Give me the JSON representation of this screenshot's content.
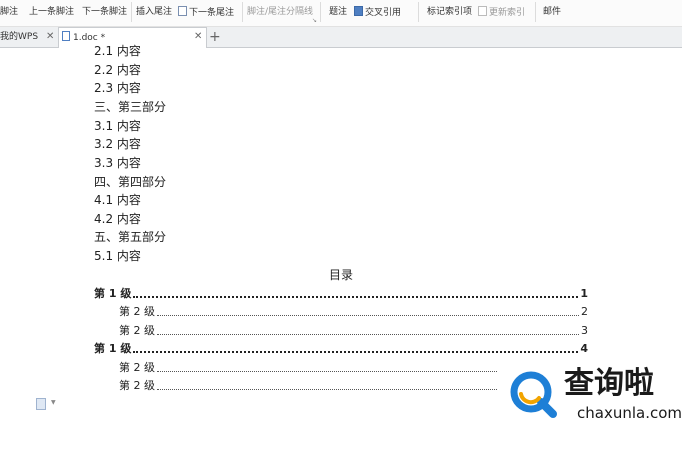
{
  "ribbon": {
    "items": [
      {
        "label": "脚注",
        "icon": "footnote-icon",
        "disabled": false
      },
      {
        "label": "上一条脚注",
        "disabled": false
      },
      {
        "label": "下一条脚注",
        "disabled": false
      },
      {
        "label": "插入尾注",
        "disabled": false
      },
      {
        "label": "下一条尾注",
        "icon": "next-endnote-icon",
        "disabled": false
      },
      {
        "label": "脚注/尾注分隔线",
        "disabled": true
      },
      {
        "label": "题注",
        "disabled": false
      },
      {
        "label": "交叉引用",
        "icon": "cross-reference-icon",
        "disabled": false
      },
      {
        "label": "标记索引项",
        "disabled": false
      },
      {
        "label": "更新索引",
        "icon": "update-index-icon",
        "disabled": true
      },
      {
        "label": "邮件",
        "disabled": false
      }
    ]
  },
  "tabs": [
    {
      "label": "我的WPS",
      "active": false
    },
    {
      "label": "1.doc *",
      "active": true
    }
  ],
  "document": {
    "lines": [
      "2.1 内容",
      "2.2 内容",
      "2.3 内容",
      "三、第三部分",
      "3.1 内容",
      "3.2 内容",
      "3.3 内容",
      "四、第四部分",
      "4.1 内容",
      "4.2 内容",
      "五、第五部分",
      "5.1 内容"
    ],
    "toc_title": "目录",
    "toc": [
      {
        "label": "第 1 级",
        "page": "1",
        "level": 1
      },
      {
        "label": "第 2 级",
        "page": "2",
        "level": 2
      },
      {
        "label": "第 2 级",
        "page": "3",
        "level": 2
      },
      {
        "label": "第 1 级",
        "page": "4",
        "level": 1
      },
      {
        "label": "第 2 级",
        "page": "",
        "level": 2
      },
      {
        "label": "第 2 级",
        "page": "",
        "level": 2
      }
    ]
  },
  "watermark": {
    "text": "查询啦",
    "url": "chaxunla.com",
    "colors": {
      "ring": "#1e7fd6",
      "accent": "#f2a400"
    }
  }
}
